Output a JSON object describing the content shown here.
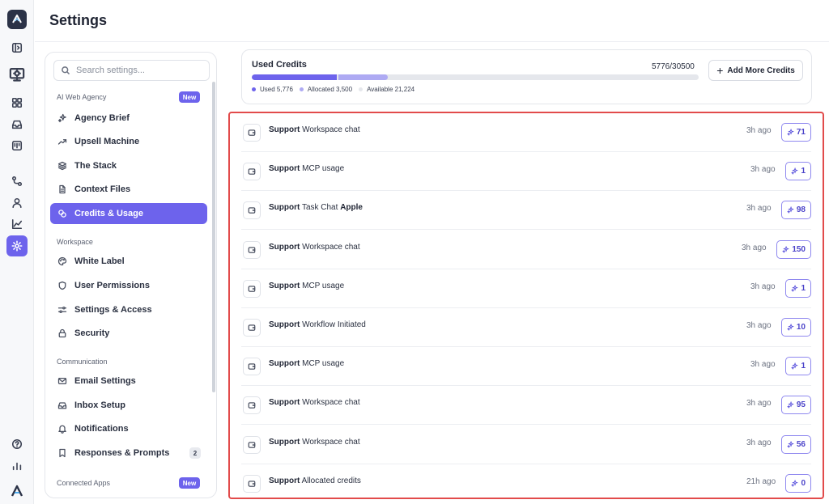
{
  "header": {
    "title": "Settings"
  },
  "rail": {
    "items": [
      "sidebar-toggle-icon",
      "computer-icon",
      "grid-icon",
      "inbox-icon",
      "board-icon",
      "flow-icon",
      "user-icon",
      "chart-icon",
      "settings-icon"
    ],
    "bottom": [
      "help-icon",
      "stats-icon",
      "brand-logo"
    ]
  },
  "search": {
    "placeholder": "Search settings..."
  },
  "nav": {
    "sections": [
      {
        "label": "AI Web Agency",
        "badge": "New",
        "items": [
          {
            "label": "Agency Brief",
            "icon": "sparkle-icon"
          },
          {
            "label": "Upsell Machine",
            "icon": "trend-up-icon"
          },
          {
            "label": "The Stack",
            "icon": "layers-icon"
          },
          {
            "label": "Context Files",
            "icon": "file-icon"
          },
          {
            "label": "Credits & Usage",
            "icon": "coins-icon",
            "active": true
          }
        ]
      },
      {
        "label": "Workspace",
        "items": [
          {
            "label": "White Label",
            "icon": "palette-icon"
          },
          {
            "label": "User Permissions",
            "icon": "shield-icon"
          },
          {
            "label": "Settings & Access",
            "icon": "sliders-icon"
          },
          {
            "label": "Security",
            "icon": "lock-icon"
          }
        ]
      },
      {
        "label": "Communication",
        "items": [
          {
            "label": "Email Settings",
            "icon": "mail-icon"
          },
          {
            "label": "Inbox Setup",
            "icon": "inbox-icon"
          },
          {
            "label": "Notifications",
            "icon": "bell-icon"
          },
          {
            "label": "Responses & Prompts",
            "icon": "bookmark-icon",
            "count": "2"
          }
        ]
      },
      {
        "label": "Connected Apps",
        "badge": "New",
        "items": []
      }
    ]
  },
  "credits": {
    "title": "Used Credits",
    "count_text": "5776/30500",
    "used_fraction": 0.1894,
    "allocated_fraction": 0.1148,
    "legend": [
      {
        "label": "Used 5,776",
        "color": "#6d63ec"
      },
      {
        "label": "Allocated 3,500",
        "color": "#aeaaf3"
      },
      {
        "label": "Available 21,224",
        "color": "#e5e7ec"
      }
    ],
    "add_button": "Add More Credits"
  },
  "activity": [
    {
      "source": "Support",
      "text": "Workspace chat",
      "extra": "",
      "time": "3h ago",
      "credits": "71"
    },
    {
      "source": "Support",
      "text": "MCP usage",
      "extra": "",
      "time": "3h ago",
      "credits": "1"
    },
    {
      "source": "Support",
      "text": "Task Chat",
      "extra": "Apple",
      "time": "3h ago",
      "credits": "98"
    },
    {
      "source": "Support",
      "text": "Workspace chat",
      "extra": "",
      "time": "3h ago",
      "credits": "150"
    },
    {
      "source": "Support",
      "text": "MCP usage",
      "extra": "",
      "time": "3h ago",
      "credits": "1"
    },
    {
      "source": "Support",
      "text": "Workflow Initiated",
      "extra": "",
      "time": "3h ago",
      "credits": "10"
    },
    {
      "source": "Support",
      "text": "MCP usage",
      "extra": "",
      "time": "3h ago",
      "credits": "1"
    },
    {
      "source": "Support",
      "text": "Workspace chat",
      "extra": "",
      "time": "3h ago",
      "credits": "95"
    },
    {
      "source": "Support",
      "text": "Workspace chat",
      "extra": "",
      "time": "3h ago",
      "credits": "56"
    },
    {
      "source": "Support",
      "text": "Allocated credits",
      "extra": "",
      "time": "21h ago",
      "credits": "0"
    }
  ]
}
